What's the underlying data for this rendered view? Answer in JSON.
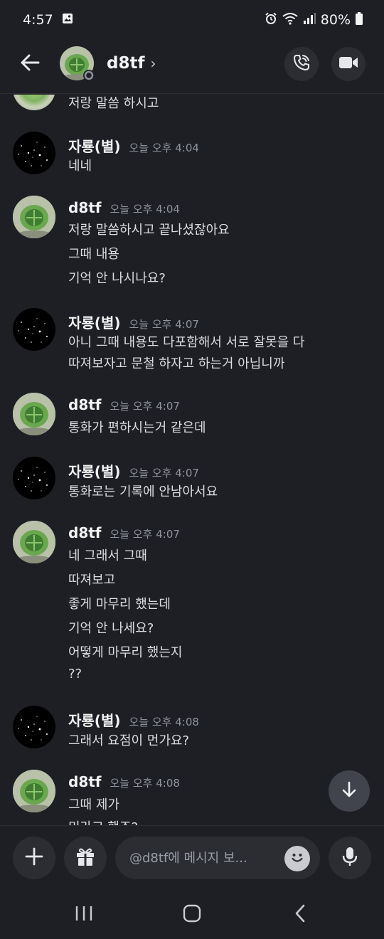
{
  "status_bar": {
    "time": "4:57",
    "battery": "80%",
    "icons": [
      "gallery-icon",
      "alarm-icon",
      "wifi-icon",
      "signal-icon",
      "battery-icon"
    ]
  },
  "header": {
    "title": "d8tf",
    "chevron": "›",
    "icons": [
      "back-arrow-icon",
      "phone-call-icon",
      "video-camera-icon"
    ]
  },
  "messages": {
    "top_partial": "저랑 말씀 하시고",
    "groups": [
      {
        "author": "자룡(별)",
        "time": "오늘 오후 4:04",
        "lines": [
          "네네"
        ]
      },
      {
        "author": "d8tf",
        "time": "오늘 오후 4:04",
        "lines": [
          "저랑 말씀하시고 끝나셨잖아요",
          "그때 내용",
          "기억 안 나시나요?"
        ]
      },
      {
        "author": "자룡(별)",
        "time": "오늘 오후 4:07",
        "lines": [
          "아니 그때 내용도 다포함해서 서로 잘못을 다",
          "따져보자고 문철 하자고 하는거 아닙니까"
        ]
      },
      {
        "author": "d8tf",
        "time": "오늘 오후 4:07",
        "lines": [
          "통화가 편하시는거 같은데"
        ]
      },
      {
        "author": "자룡(별)",
        "time": "오늘 오후 4:07",
        "lines": [
          "통화로는 기록에 안남아서요"
        ]
      },
      {
        "author": "d8tf",
        "time": "오늘 오후 4:07",
        "lines": [
          "네 그래서 그때",
          "따져보고",
          "좋게 마무리 했는데",
          "기억 안 나세요?",
          "어떻게 마무리 했는지",
          "??"
        ]
      },
      {
        "author": "자룡(별)",
        "time": "오늘 오후 4:08",
        "lines": [
          "그래서 요점이 먼가요?"
        ]
      },
      {
        "author": "d8tf",
        "time": "오늘 오후 4:08",
        "lines": [
          "그때 제가",
          "미라고 했죠?"
        ]
      }
    ]
  },
  "composer": {
    "placeholder": "@d8tf에 메시지 보...",
    "icons": [
      "plus-icon",
      "gift-icon",
      "emoji-icon",
      "microphone-icon",
      "arrow-down-icon"
    ]
  },
  "nav": {
    "icons": [
      "recent-apps-icon",
      "home-icon",
      "back-icon"
    ]
  },
  "colors": {
    "background": "#1e1f24",
    "button_bg": "#2b2d33",
    "timestamp": "#8f939c"
  }
}
